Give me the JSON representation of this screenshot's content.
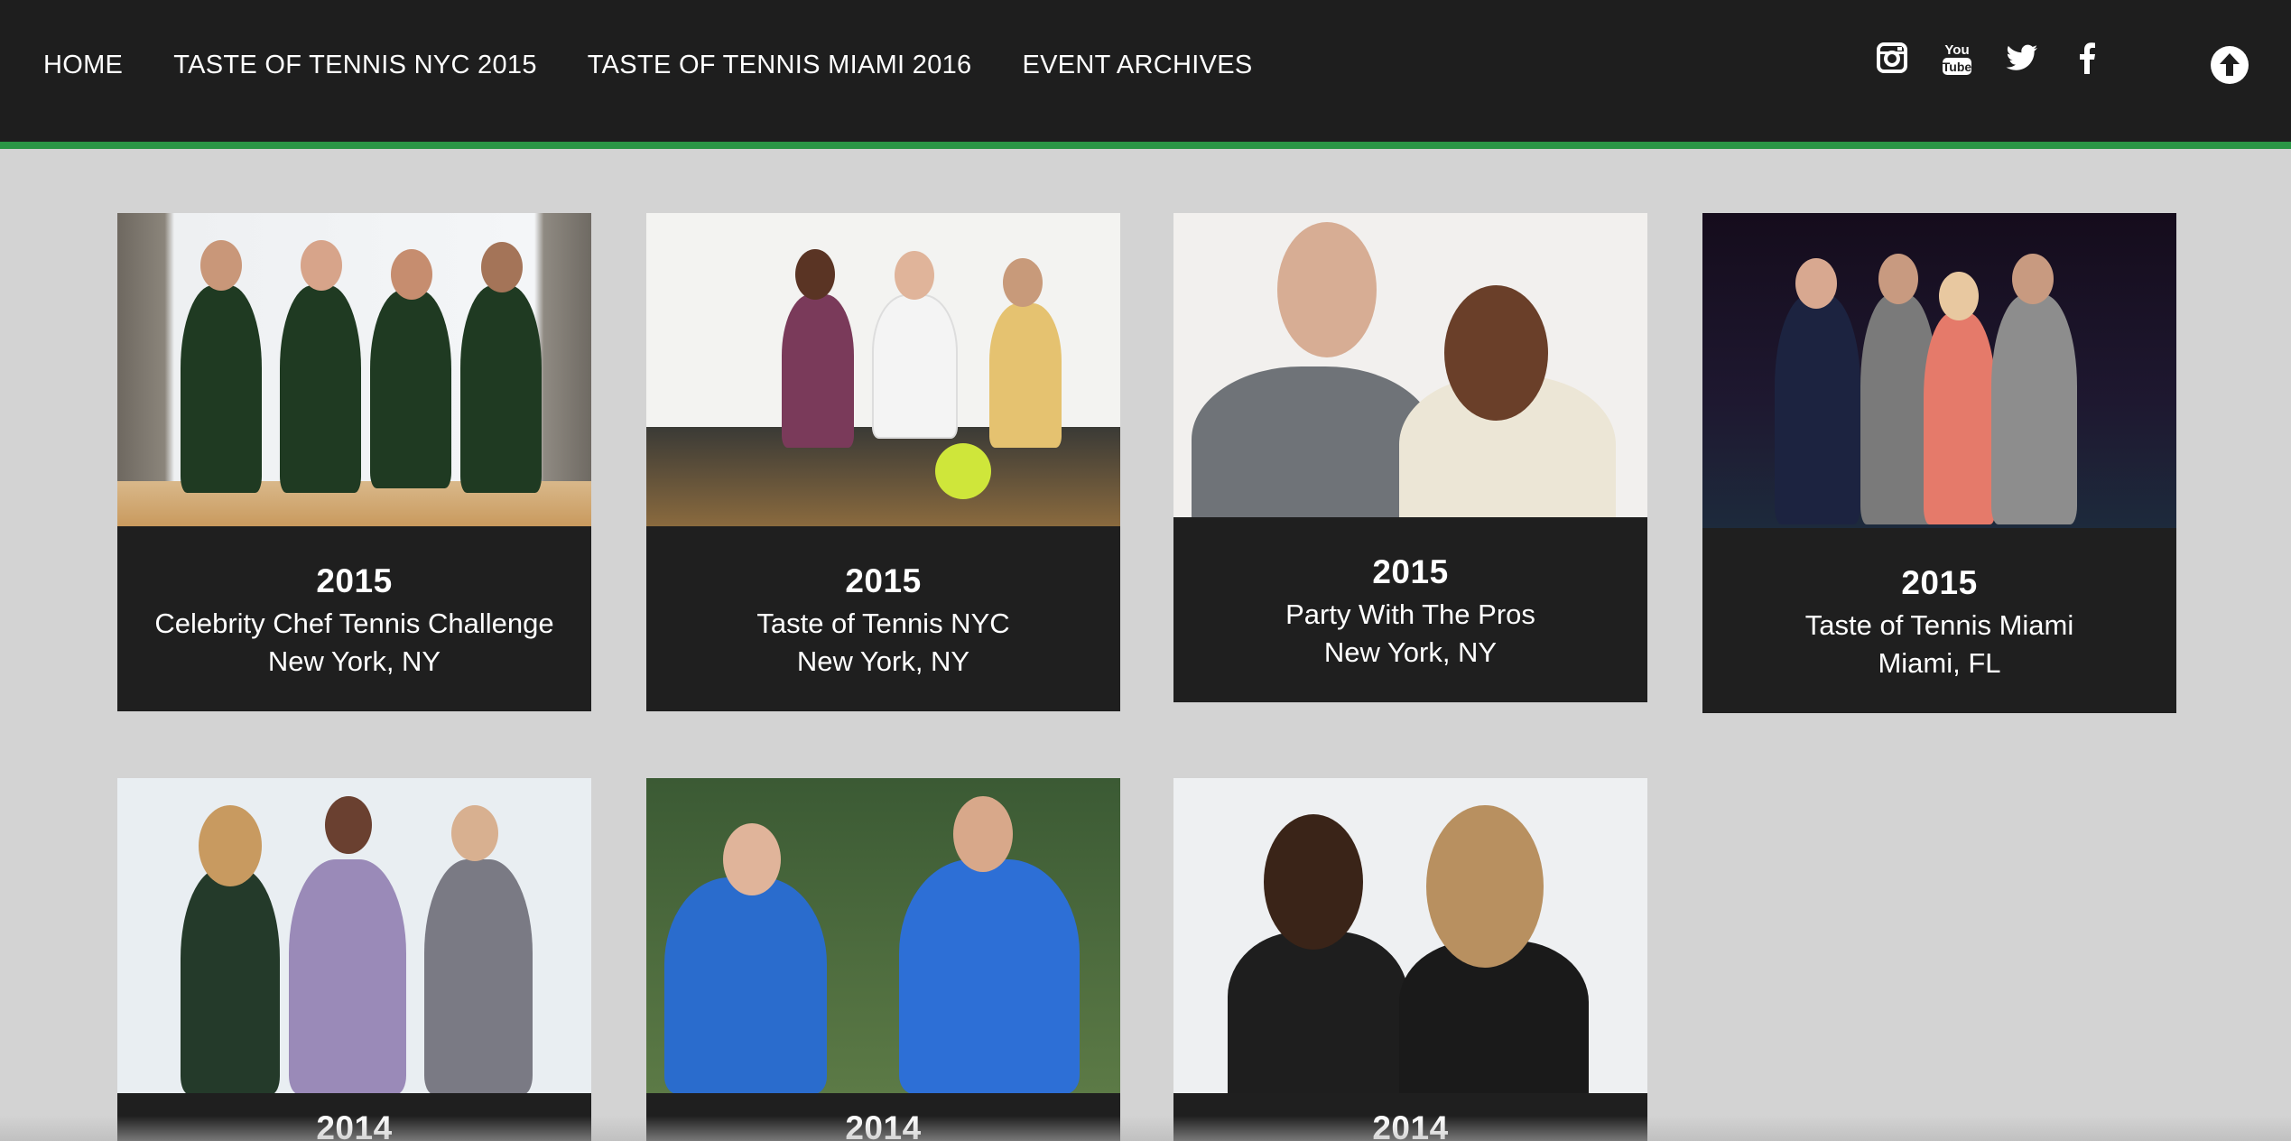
{
  "nav": {
    "items": [
      {
        "label": "HOME"
      },
      {
        "label": "TASTE OF TENNIS NYC 2015"
      },
      {
        "label": "TASTE OF TENNIS MIAMI 2016"
      },
      {
        "label": "EVENT ARCHIVES"
      }
    ]
  },
  "social": {
    "icons": [
      "instagram-icon",
      "youtube-icon",
      "twitter-icon",
      "facebook-icon"
    ]
  },
  "scroll_top": {
    "icon": "arrow-up-circle-icon"
  },
  "colors": {
    "header_bg": "#1e1e1e",
    "accent_stripe": "#2a9645",
    "page_bg": "#d3d3d3",
    "card_bg": "#1f1f1f"
  },
  "events": [
    {
      "year": "2015",
      "title": "Celebrity Chef Tennis Challenge",
      "location": "New York, NY"
    },
    {
      "year": "2015",
      "title": "Taste of Tennis NYC",
      "location": "New York, NY"
    },
    {
      "year": "2015",
      "title": "Party With The Pros",
      "location": "New York, NY"
    },
    {
      "year": "2015",
      "title": "Taste of Tennis Miami",
      "location": "Miami, FL"
    },
    {
      "year": "2014",
      "title": "",
      "location": ""
    },
    {
      "year": "2014",
      "title": "",
      "location": ""
    },
    {
      "year": "2014",
      "title": "",
      "location": ""
    }
  ]
}
